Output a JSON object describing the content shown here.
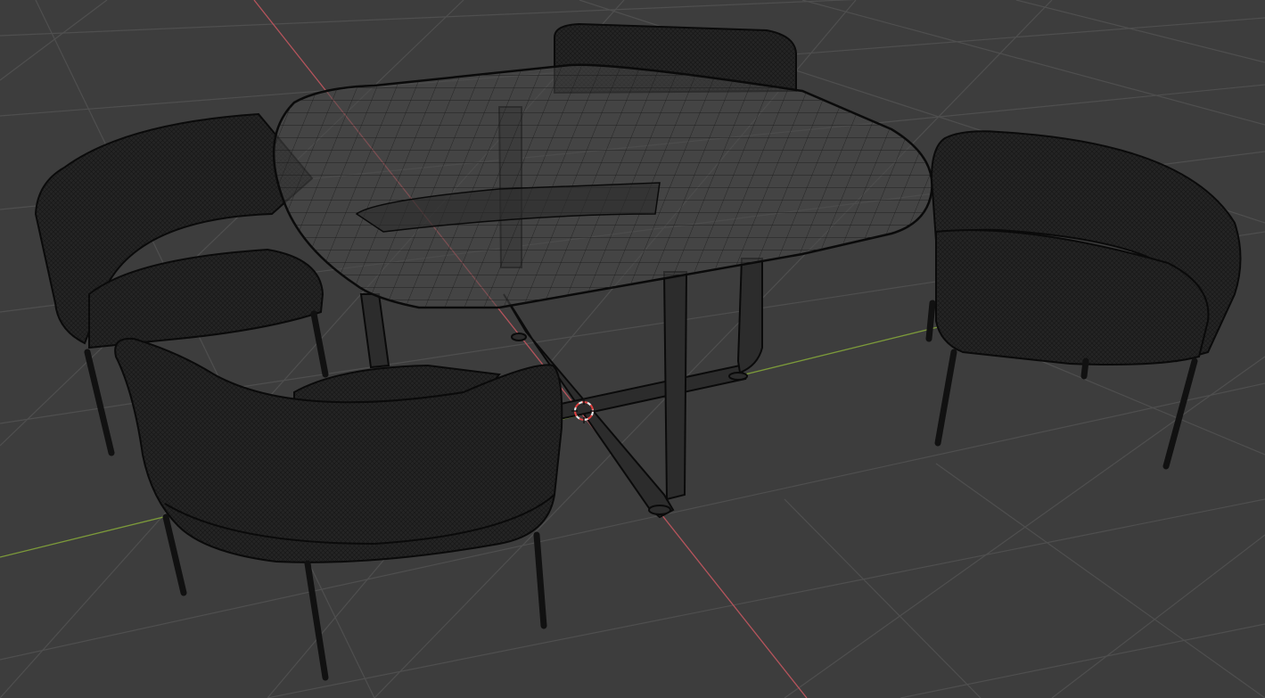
{
  "viewport": {
    "background": "#3d3d3d",
    "grid_color": "#4f4f4f",
    "x_axis_color": "#b6545c",
    "y_axis_color": "#7c9a3a",
    "wire_color": "#0a0a0a",
    "fabric_color": "#262626",
    "glass_color": "#4a4a4a",
    "cursor_color": "#e04040"
  },
  "scene": {
    "objects": [
      "dining-table",
      "chair-back",
      "chair-left",
      "chair-right",
      "chair-front"
    ],
    "shading": "wireframe-overlay"
  },
  "icons": {
    "cursor": "3d-cursor-icon"
  }
}
